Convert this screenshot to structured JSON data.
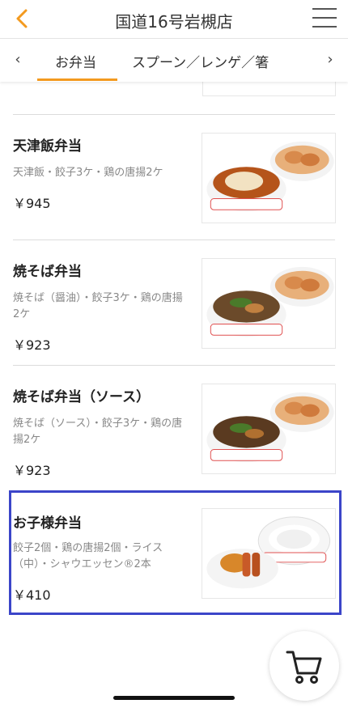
{
  "header": {
    "title": "国道16号岩槻店",
    "accent_color": "#f39a1f"
  },
  "tabs": {
    "active_label": "お弁当",
    "next_label": "スプーン／レンゲ／箸"
  },
  "items": [
    {
      "name": "天津飯弁当",
      "desc": "天津飯・餃子3ケ・鶏の唐揚2ケ",
      "price": "￥945"
    },
    {
      "name": "焼そば弁当",
      "desc": "焼そば（醤油）・餃子3ケ・鶏の唐揚2ケ",
      "price": "￥923"
    },
    {
      "name": "焼そば弁当（ソース）",
      "desc": "焼そば（ソース）・餃子3ケ・鶏の唐揚2ケ",
      "price": "￥923"
    },
    {
      "name": "お子様弁当",
      "desc": "餃子2個・鶏の唐揚2個・ライス（中）・シャウエッセン®2本",
      "price": "￥410"
    }
  ],
  "icons": {
    "back": "chevron-left-icon",
    "menu": "hamburger-menu-icon",
    "cart": "shopping-cart-icon"
  },
  "selection_color": "#3b45c9"
}
